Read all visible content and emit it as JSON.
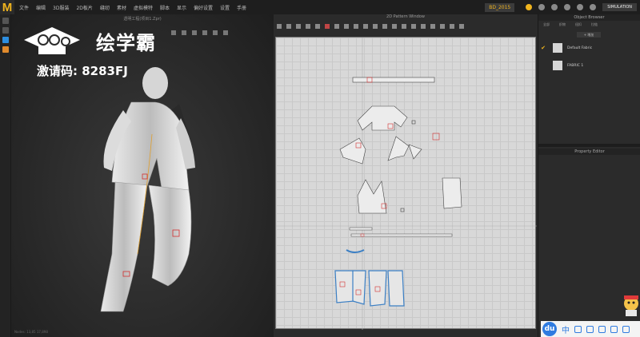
{
  "app": {
    "logo": "M"
  },
  "menu": [
    "文件",
    "编辑",
    "3D服装",
    "2D板片",
    "缝纫",
    "素材",
    "虚拟模特",
    "脚本",
    "显示",
    "偏好设置",
    "设置",
    "手册"
  ],
  "topbar": {
    "brand": "BD_2015",
    "sim_label": "SIMULATION"
  },
  "view3d": {
    "title": "透明工程(项目1.Zpr)",
    "footer": "Nodes: 13,85  17,898"
  },
  "watermark": {
    "title": "绘学霸",
    "code": "激请码: 8283FJ"
  },
  "view2d": {
    "title": "2D Pattern Window"
  },
  "object_browser": {
    "title": "Object Browser",
    "tabs": [
      "全部",
      "织物",
      "纽扣",
      "拉链"
    ],
    "add_label": "+ 增加",
    "items": [
      {
        "name": "Default Fabric",
        "checked": true
      },
      {
        "name": "FABRIC 1",
        "checked": false
      }
    ]
  },
  "property_editor": {
    "title": "Property Editor"
  },
  "ime": {
    "logo": "du",
    "lang": "中"
  },
  "colors": {
    "accent": "#f0b41e",
    "pattern_outline": "#3b7fc4",
    "pattern_red": "#d23030"
  }
}
